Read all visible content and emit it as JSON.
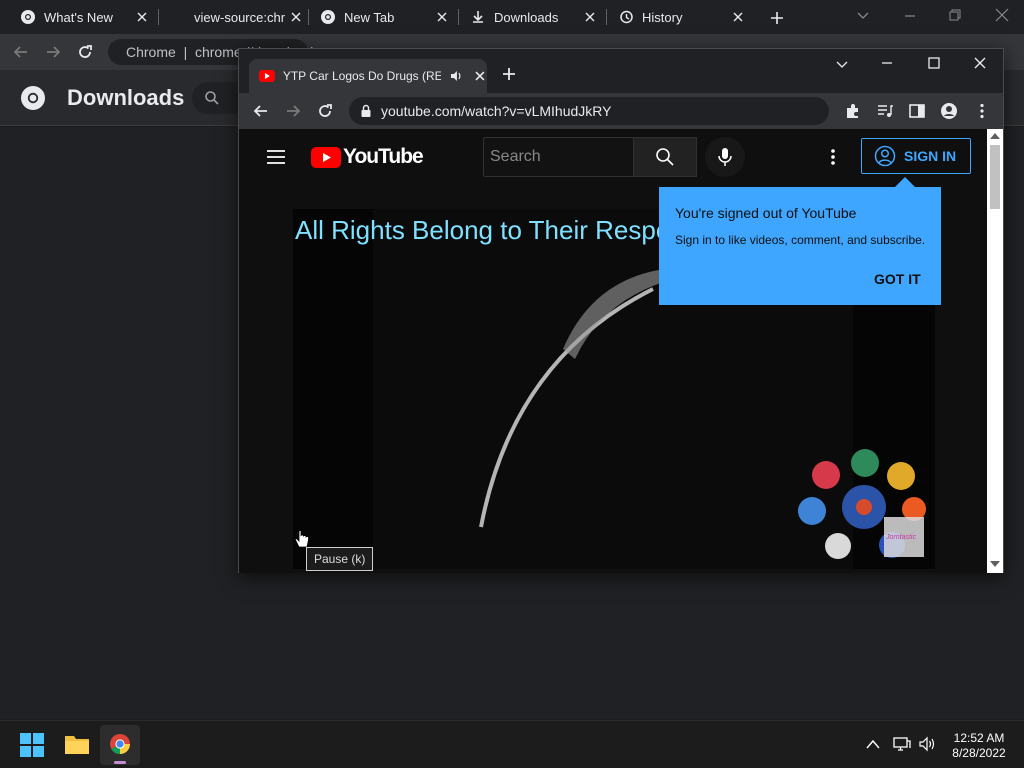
{
  "background_window": {
    "tabs": [
      {
        "label": "What's New"
      },
      {
        "label": "view-source:chr"
      },
      {
        "label": "New Tab"
      },
      {
        "label": "Downloads"
      },
      {
        "label": "History"
      }
    ],
    "omnibox_text": "Chrome  |  chrome://downloads",
    "page_title": "Downloads"
  },
  "popup_window": {
    "tab_title": "YTP Car Logos Do Drugs (RE",
    "url": "youtube.com/watch?v=vLMIhudJkRY"
  },
  "youtube": {
    "logo_text": "YouTube",
    "search_placeholder": "Search",
    "sign_in_label": "SIGN IN",
    "caption_text": "All Rights Belong to Their Respect",
    "tooltip": {
      "title": "You're signed out of YouTube",
      "subtitle": "Sign in to like videos, comment, and subscribe.",
      "button": "GOT IT"
    },
    "pause_tooltip": "Pause (k)",
    "watermark_text": "Jorntastic"
  },
  "taskbar": {
    "time": "12:52 AM",
    "date": "8/28/2022"
  },
  "colors": {
    "accent_blue": "#3ea6ff",
    "youtube_red": "#ff0000",
    "caption_cyan": "#7fe0ff"
  }
}
